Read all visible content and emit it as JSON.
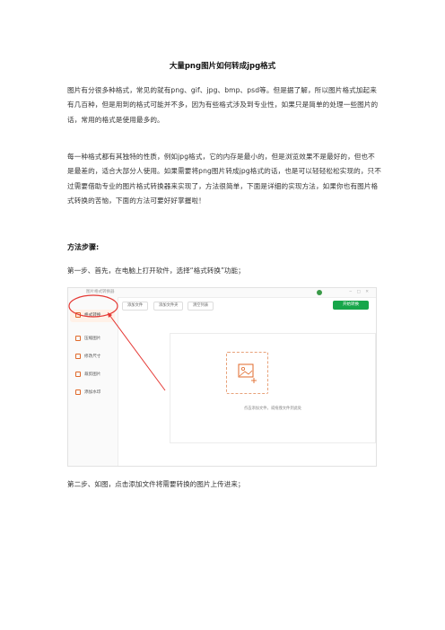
{
  "document": {
    "title": "大量png图片如何转成jpg格式",
    "paragraph1": "图片有分很多种格式，常见的就有png、gif、jpg、bmp、psd等。但是据了解，所以图片格式加起来有几百种，但是用到的格式可能并不多，因为有些格式涉及到专业性，如果只是简单的处理一些图片的话，常用的格式是使用最多的。",
    "paragraph2": "每一种格式都有其独特的性质，例如jpg格式，它的内存是最小的，但是浏览效果不是最好的，但也不是最差的，适合大部分人使用。如果需要将png图片转成jpg格式的话，也是可以轻轻松松实现的，只不过需要借助专业的图片格式转换器来实现了，方法很简单，下面是详细的实现方法，如果你也有图片格式转换的苦恼，下面的方法可要好好掌握啦！",
    "method_heading": "方法步骤:",
    "step1": "第一步、首先，在电脑上打开软件，选择“格式转换”功能；",
    "step2": "第二步、如图，点击添加文件将需要转换的图片上传进来；"
  },
  "screenshot": {
    "app_title": "图片格式转换器",
    "window_controls": "─ □ ✕",
    "sidebar": [
      {
        "label": "格式转换",
        "icon": "convert-icon"
      },
      {
        "label": "压缩图片",
        "icon": "compress-icon"
      },
      {
        "label": "修改尺寸",
        "icon": "resize-icon"
      },
      {
        "label": "裁剪图片",
        "icon": "crop-icon"
      },
      {
        "label": "添加水印",
        "icon": "watermark-icon"
      }
    ],
    "toolbar": {
      "add_file": "添加文件",
      "add_folder": "添加文件夹",
      "clear_list": "清空列表",
      "start": "开始转换"
    },
    "dropzone_text": "点击添加文件，或拖拽文件到此处",
    "accent_color": "#e0692a",
    "start_color": "#17a64a",
    "annotation_color": "#e53935"
  }
}
